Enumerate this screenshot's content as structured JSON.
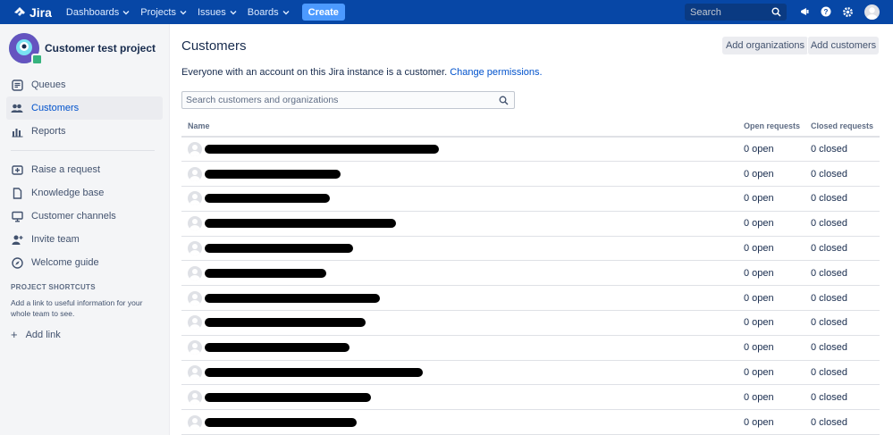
{
  "topnav": {
    "logo_text": "Jira",
    "items": [
      {
        "label": "Dashboards"
      },
      {
        "label": "Projects"
      },
      {
        "label": "Issues"
      },
      {
        "label": "Boards"
      }
    ],
    "create_label": "Create",
    "search_placeholder": "Search",
    "icons": [
      "megaphone-icon",
      "help-icon",
      "settings-icon"
    ],
    "brand_color": "#0747a6"
  },
  "sidebar": {
    "project_name": "Customer test project",
    "items": [
      {
        "label": "Queues",
        "icon": "queues-icon"
      },
      {
        "label": "Customers",
        "icon": "customers-icon",
        "active": true
      },
      {
        "label": "Reports",
        "icon": "reports-icon"
      }
    ],
    "items2": [
      {
        "label": "Raise a request",
        "icon": "raise-request-icon"
      },
      {
        "label": "Knowledge base",
        "icon": "knowledge-base-icon"
      },
      {
        "label": "Customer channels",
        "icon": "monitor-icon"
      },
      {
        "label": "Invite team",
        "icon": "invite-team-icon"
      },
      {
        "label": "Welcome guide",
        "icon": "compass-icon"
      }
    ],
    "shortcuts_title": "PROJECT SHORTCUTS",
    "shortcuts_desc": "Add a link to useful information for your whole team to see.",
    "add_link_label": "Add link"
  },
  "main": {
    "title": "Customers",
    "add_organizations_label": "Add organizations",
    "add_customers_label": "Add customers",
    "info_text": "Everyone with an account on this Jira instance is a customer.",
    "info_link": "Change permissions.",
    "search_placeholder": "Search customers and organizations",
    "columns": {
      "name": "Name",
      "open": "Open requests",
      "closed": "Closed requests"
    },
    "rows": [
      {
        "open": "0 open",
        "closed": "0 closed",
        "redact_w": 262
      },
      {
        "open": "0 open",
        "closed": "0 closed",
        "redact_w": 152
      },
      {
        "open": "0 open",
        "closed": "0 closed",
        "redact_w": 140
      },
      {
        "open": "0 open",
        "closed": "0 closed",
        "redact_w": 214
      },
      {
        "open": "0 open",
        "closed": "0 closed",
        "redact_w": 166
      },
      {
        "open": "0 open",
        "closed": "0 closed",
        "redact_w": 136
      },
      {
        "open": "0 open",
        "closed": "0 closed",
        "redact_w": 196
      },
      {
        "open": "0 open",
        "closed": "0 closed",
        "redact_w": 180
      },
      {
        "open": "0 open",
        "closed": "0 closed",
        "redact_w": 162
      },
      {
        "open": "0 open",
        "closed": "0 closed",
        "redact_w": 244
      },
      {
        "open": "0 open",
        "closed": "0 closed",
        "redact_w": 186
      },
      {
        "open": "0 open",
        "closed": "0 closed",
        "redact_w": 170
      }
    ]
  }
}
